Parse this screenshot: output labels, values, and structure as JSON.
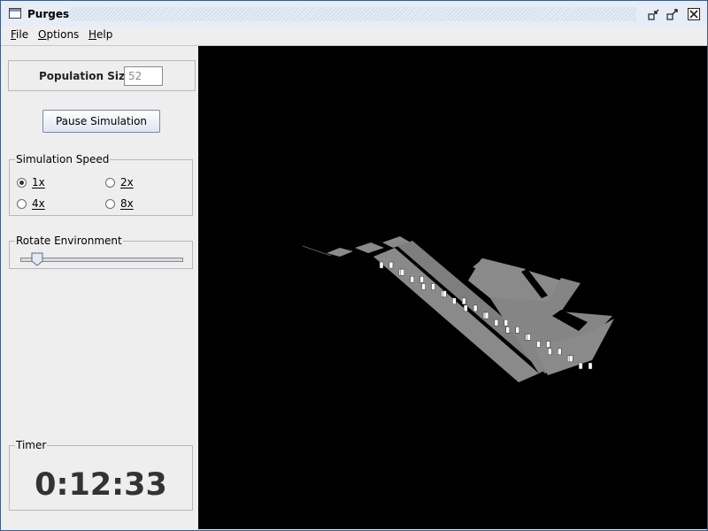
{
  "window": {
    "title": "Purges"
  },
  "titlebar_icons": [
    "app-icon",
    "minimize-icon",
    "maximize-icon",
    "close-icon"
  ],
  "menu": [
    {
      "label": "File"
    },
    {
      "label": "Options"
    },
    {
      "label": "Help"
    }
  ],
  "population": {
    "label": "Population Size:",
    "value": "52"
  },
  "pause_button": {
    "label": "Pause Simulation"
  },
  "speed": {
    "title": "Simulation Speed",
    "options": [
      {
        "label": "1x",
        "selected": true
      },
      {
        "label": "2x",
        "selected": false
      },
      {
        "label": "4x",
        "selected": false
      },
      {
        "label": "8x",
        "selected": false
      }
    ]
  },
  "rotate": {
    "title": "Rotate Environment",
    "value_fraction": 0.1
  },
  "timer": {
    "title": "Timer",
    "value": "0:12:33"
  },
  "scene": {
    "background": "#000000",
    "environment_color": "#8a8a8a",
    "agent_color": "#ffffff"
  }
}
